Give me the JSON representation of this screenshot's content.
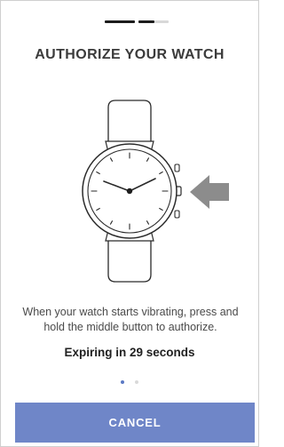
{
  "step_indicator": {
    "segments": 3,
    "completed": 2
  },
  "title": "AUTHORIZE YOUR WATCH",
  "illustration": {
    "icon": "smartwatch-icon",
    "pointer_icon": "left-arrow-icon",
    "colors": {
      "strap": "#ffffff",
      "outline": "#2a2a2a",
      "arrow": "#8c8c8c"
    }
  },
  "instruction_text": "When your watch starts vibrating, press and hold the middle button to authorize.",
  "expiry_text": "Expiring in 29 seconds",
  "pagination": {
    "total": 2,
    "active": 1
  },
  "cancel_button": {
    "label": "CANCEL",
    "color": "#6f86c8"
  }
}
